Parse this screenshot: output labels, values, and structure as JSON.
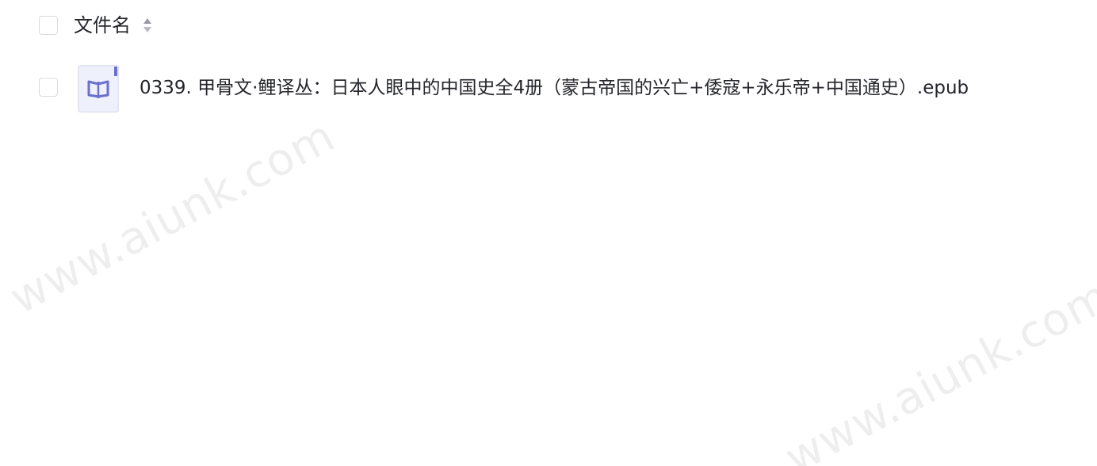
{
  "header": {
    "name_label": "文件名",
    "sort_icon": "sort-caret-icon"
  },
  "files": [
    {
      "icon": "book-icon",
      "name": "0339. 甲骨文·鲤译丛：日本人眼中的中国史全4册（蒙古帝国的兴亡+倭寇+永乐帝+中国通史）.epub"
    }
  ],
  "watermarks": [
    "www.aiunk.com",
    "www.aiunk.com"
  ],
  "colors": {
    "text": "#25262b",
    "checkbox_border": "#d9dbe0",
    "icon_accent": "#6b6fd0",
    "icon_bg": "#eef0fb",
    "watermark": "#787878"
  }
}
